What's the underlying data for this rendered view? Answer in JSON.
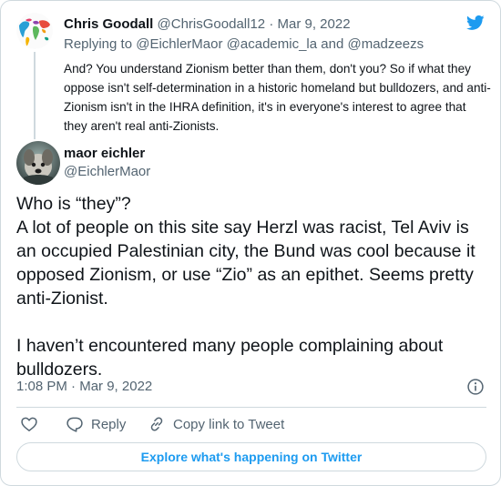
{
  "parent": {
    "author_name": "Chris Goodall",
    "author_handle": "@ChrisGoodall12",
    "separator": "·",
    "date": "Mar 9, 2022",
    "replying_prefix": "Replying to",
    "reply_to_1": "@EichlerMaor",
    "reply_to_2": "@academic_la",
    "reply_and": "and",
    "reply_to_3": "@madzeezs",
    "text": "And? You understand Zionism better than them, don't you? So if what they oppose isn't self-determination in a historic homeland but bulldozers, and anti-Zionism isn't in the IHRA definition, it's in everyone's interest to agree that they aren't real anti-Zionists."
  },
  "tweet": {
    "author_name": "maor eichler",
    "author_handle": "@EichlerMaor",
    "paragraph_1": "Who is “they”?\nA lot of people on this site say Herzl was racist, Tel Aviv is an occupied Palestinian city, the Bund was cool because it opposed Zionism, or use “Zio” as an epithet. Seems pretty anti-Zionist.",
    "paragraph_2": "I haven’t encountered many people complaining about bulldozers.",
    "time": "1:08 PM",
    "separator": "·",
    "date": "Mar 9, 2022"
  },
  "actions": {
    "reply_label": "Reply",
    "copy_link_label": "Copy link to Tweet"
  },
  "explore_label": "Explore what's happening on Twitter",
  "colors": {
    "accent": "#1d9bf0",
    "text": "#0f1419",
    "secondary": "#536471",
    "border": "#cfd9de"
  },
  "icons": {
    "brand": "twitter-bird-icon",
    "info": "info-icon",
    "like": "heart-icon",
    "reply": "speech-bubble-icon",
    "copy_link": "link-icon"
  }
}
